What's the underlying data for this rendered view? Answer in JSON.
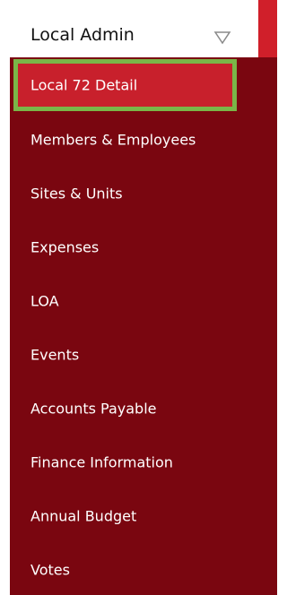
{
  "header": {
    "title": "Local Admin",
    "dropdown_icon": "triangle-down-outline-icon"
  },
  "menu": {
    "items": [
      {
        "label": "Local 72 Detail",
        "active": true
      },
      {
        "label": "Members & Employees",
        "active": false
      },
      {
        "label": "Sites & Units",
        "active": false
      },
      {
        "label": "Expenses",
        "active": false
      },
      {
        "label": "LOA",
        "active": false
      },
      {
        "label": "Events",
        "active": false
      },
      {
        "label": "Accounts Payable",
        "active": false
      },
      {
        "label": "Finance Information",
        "active": false
      },
      {
        "label": "Annual Budget",
        "active": false
      },
      {
        "label": "Votes",
        "active": false
      }
    ]
  },
  "colors": {
    "menu_background": "#7a0610",
    "active_background": "#c8202c",
    "active_border": "#7ab648",
    "accent_strip": "#d01f2a",
    "menu_text": "#ffffff",
    "header_text": "#111111"
  }
}
